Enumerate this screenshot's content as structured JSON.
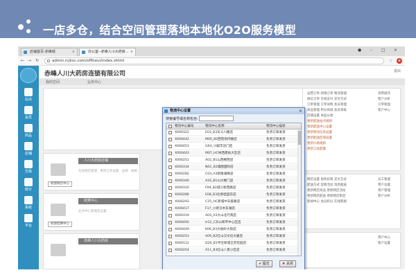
{
  "banner": {
    "title": "一店多仓，结合空间管理落地本地化O2O服务模型"
  },
  "browser": {
    "tabs": [
      {
        "label": "店铺首页-赤峰城"
      },
      {
        "label": "办公室--赤峰人川大药房..."
      }
    ],
    "url": "admin.rcjksc.com/officeui/index.shtml"
  },
  "app": {
    "company": "赤峰人川大药房连锁有限公司",
    "logout": "退出",
    "subnav": [
      "我的空间",
      "业务中心"
    ],
    "sidebar": [
      {
        "label": "站点",
        "icon": "home-icon"
      },
      {
        "label": "会员",
        "icon": "users-icon"
      },
      {
        "label": "商品",
        "icon": "box-icon"
      },
      {
        "label": "店铺",
        "icon": "store-icon"
      },
      {
        "label": "交易",
        "icon": "check-icon"
      },
      {
        "label": "统计",
        "icon": "chart-icon"
      },
      {
        "label": "系统",
        "icon": "monitor-icon"
      },
      {
        "label": "平台",
        "icon": "tools-icon"
      }
    ],
    "panels": [
      {
        "title": "人川大药房店铺",
        "button": "新建网店中心",
        "text": "包括网店管理 · 更改订单设置 · 品牌 · 规格"
      },
      {
        "title": "结算中心",
        "button": "新建结算中心",
        "text": "业务中心管理及设置..."
      },
      {
        "title": "赤峰人川大药房",
        "button": "",
        "text": ""
      }
    ],
    "links_right_top": [
      "运营订单",
      "新增订单",
      "物流管理",
      "微信订单",
      "在线支付",
      "支付方式",
      "订单管理",
      "订单详情",
      "会员管理",
      "商品管理",
      "积分商城",
      "会员等级",
      "店铺设置",
      "商品分类",
      "更新配送站点规则",
      "更新配送中心设置",
      "更新物流信息设置",
      "更新配送区域设置",
      "更新价格规则",
      "更新工具配置"
    ],
    "links_right_mid": [
      "网店设置",
      "角色权限",
      "支付方式",
      "配送方式",
      "促销活动",
      "消息推送",
      "更新网店商品",
      "更新网店活动",
      "更新网店配送",
      "更新网店售后",
      "新闻中心",
      "会员积分",
      "在线客服"
    ],
    "side_labels": [
      "常用操作",
      "客户分析",
      "订单管理",
      "客户中心",
      "员工管理",
      "用户设置",
      "用户管理",
      "客户分析",
      "用户中心",
      "客户设置"
    ]
  },
  "modal": {
    "title": "物流中心设置",
    "search_label": "搜索编号或名称包含:",
    "search_value": "",
    "columns": [
      "物流中心编号",
      "物流中心名称",
      "物流中心描述"
    ],
    "rows": [
      [
        "X000322",
        "E03_B3天义川路店",
        "负责订单发货"
      ],
      [
        "X000442",
        "M05_B2西院洞内楼店",
        "负责订单发货"
      ],
      [
        "X000453",
        "G04_小嗣丰创门店",
        "负责订单发货"
      ],
      [
        "X000443",
        "M07_HC林西建省大区店",
        "负责订单发货"
      ],
      [
        "X000251",
        "A02_B1山西楼西店",
        "负责订单发货"
      ],
      [
        "X000334",
        "N02_B3城圈国际店",
        "负责订单发货"
      ],
      [
        "X000282",
        "C03_A3新陵湖路店",
        "负责订单发货"
      ],
      [
        "X000346",
        "A16_B1山大楼门店",
        "负责订单发货"
      ],
      [
        "X000316",
        "F09_B2城义新西路店",
        "负责订单发货"
      ],
      [
        "X000286",
        "E08_B3北新桂园东店",
        "负责订单发货"
      ],
      [
        "X000293",
        "C25_HC新城中天级路店",
        "负责订单发货"
      ],
      [
        "X000417",
        "F17_小新汉木东湖店",
        "负责订单发货"
      ],
      [
        "X000319",
        "A03_A3大山北行南店",
        "负责订单发货"
      ],
      [
        "X000492",
        "H12_C天山和平中心区店",
        "负责订单发货"
      ],
      [
        "X000449",
        "K06_B3大板岭大街店",
        "负责订单发货"
      ],
      [
        "X000253",
        "A09_B2红山汉文化大厦店",
        "负责订单发货"
      ],
      [
        "X000112",
        "D26_B1平庄新城王府花园店",
        "负责订单发货"
      ],
      [
        "X000254",
        "A11_B3红山八景小区店",
        "负责订单发货"
      ]
    ],
    "ok_label": "提交",
    "close_label": "关闭"
  }
}
